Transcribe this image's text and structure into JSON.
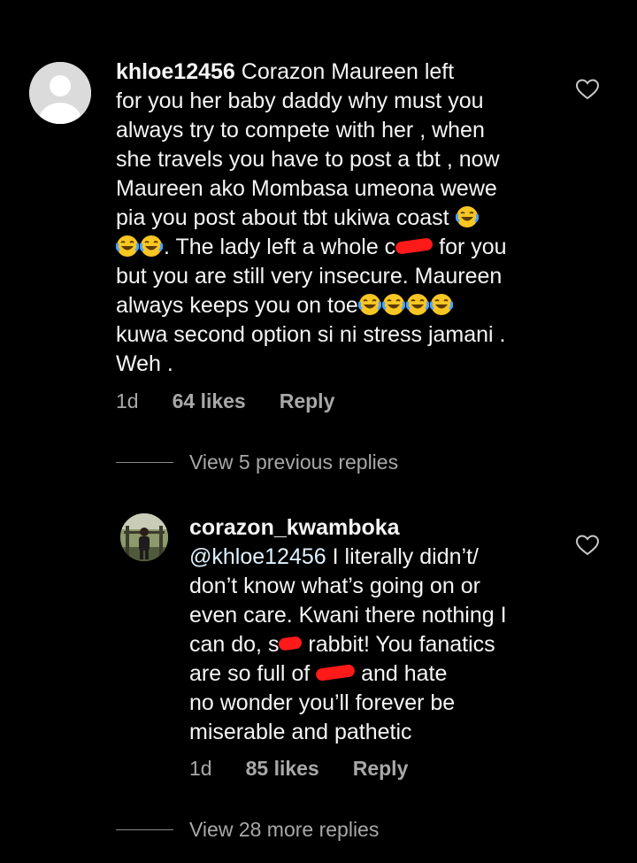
{
  "comments": [
    {
      "username": "khloe12456",
      "text_lines": [
        "Corazon Maureen left",
        "for you her baby daddy why must you",
        "always try to compete with her , when",
        "she travels you have to post a tbt , now",
        "Maureen ako Mombasa umeona wewe",
        "pia you post about tbt ukiwa coast",
        ". The lady left a whole c",
        "for you",
        "but you are still very insecure. Maureen",
        "always keeps you on toe",
        "kuwa second option si ni stress jamani .",
        "Weh ."
      ],
      "time": "1d",
      "likes": "64 likes",
      "reply_label": "Reply"
    },
    {
      "username": "corazon_kwamboka",
      "mention": "@khloe12456",
      "text_lines": [
        "I literally didn’t/",
        "don’t know what’s going on or",
        "even care. Kwani there nothing I",
        "can do, s",
        "rabbit! You fanatics",
        "are so full of",
        "and hate",
        "no wonder you’ll forever be",
        "miserable and pathetic"
      ],
      "time": "1d",
      "likes": "85 likes",
      "reply_label": "Reply"
    }
  ],
  "view_previous_replies": "View 5 previous replies",
  "view_more_replies": "View 28 more replies",
  "icons": {
    "heart": "heart-outline-icon",
    "emoji": "face-with-tears-of-joy-emoji"
  },
  "colors": {
    "background": "#000000",
    "text": "#f5f5f5",
    "muted": "#a8a8a8",
    "redaction": "#ff1a1a"
  }
}
